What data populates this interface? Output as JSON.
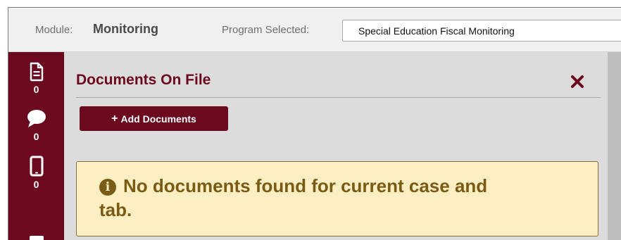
{
  "header": {
    "module_label": "Module:",
    "module_value": "Monitoring",
    "program_label": "Program Selected:",
    "program_value": "Special Education Fiscal Monitoring"
  },
  "rail": {
    "items": [
      {
        "icon": "document-icon",
        "count": "0"
      },
      {
        "icon": "comment-icon",
        "count": "0"
      },
      {
        "icon": "mobile-phone-icon",
        "count": "0"
      }
    ]
  },
  "panel": {
    "title": "Documents On File",
    "close_icon": "close-icon",
    "add_label": "Add Documents",
    "add_icon": "+",
    "alert_icon": "info-icon",
    "alert_message": "No documents found for current case and tab."
  },
  "colors": {
    "brand": "#6b0a1f",
    "alert_bg": "#fdefc3",
    "alert_text": "#7a5b16"
  }
}
